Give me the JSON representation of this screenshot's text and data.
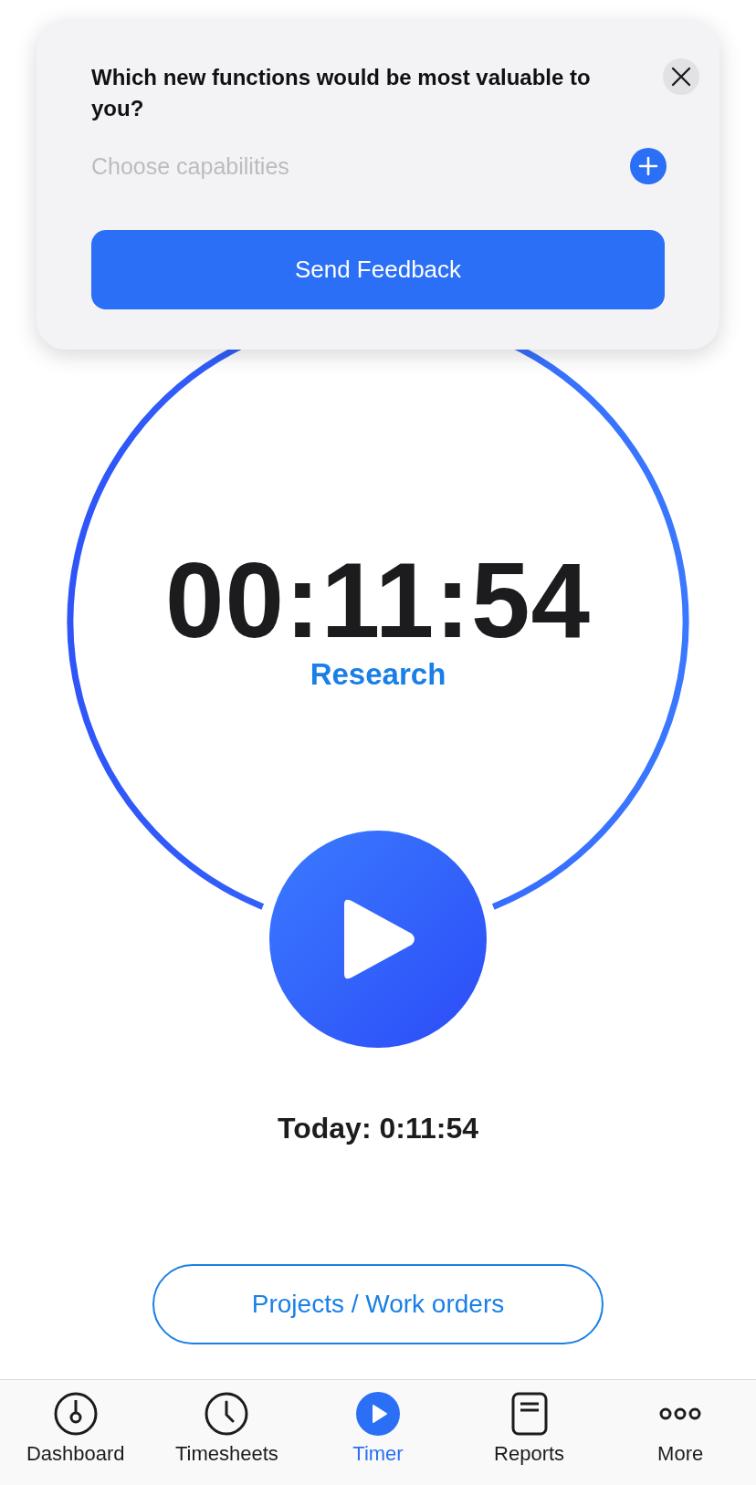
{
  "feedback_card": {
    "question": "Which new functions would be most valuable to you?",
    "capabilities_field": {
      "placeholder": "Choose capabilities"
    },
    "submit_button": "Send Feedback"
  },
  "timer": {
    "elapsed": "00:11:54",
    "activity": "Research",
    "running": false
  },
  "today_total": "Today: 0:11:54",
  "projects_button": "Projects / Work orders",
  "tab_bar": [
    {
      "kind": "dashboard",
      "label": "Dashboard",
      "selected": false
    },
    {
      "kind": "timesheets",
      "label": "Timesheets",
      "selected": false
    },
    {
      "kind": "timer",
      "label": "Timer",
      "selected": true
    },
    {
      "kind": "reports",
      "label": "Reports",
      "selected": false
    },
    {
      "kind": "more",
      "label": "More",
      "selected": false
    }
  ]
}
